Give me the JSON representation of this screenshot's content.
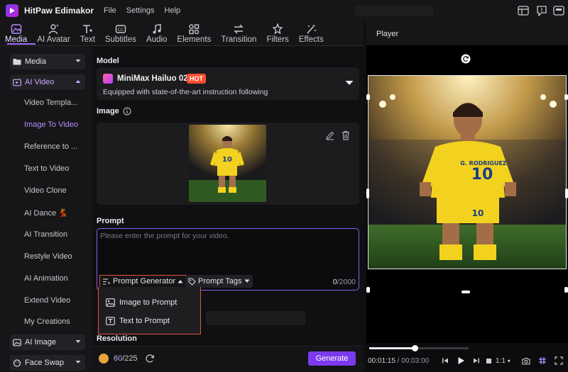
{
  "app": {
    "title": "HitPaw Edimakor",
    "menu": [
      "File",
      "Settings",
      "Help"
    ]
  },
  "toolbar": {
    "tabs": [
      {
        "label": "Media",
        "icon": "media-icon",
        "active": true
      },
      {
        "label": "AI Avatar",
        "icon": "avatar-icon"
      },
      {
        "label": "Text",
        "icon": "text-icon"
      },
      {
        "label": "Subtitles",
        "icon": "subtitles-icon"
      },
      {
        "label": "Audio",
        "icon": "audio-icon"
      },
      {
        "label": "Elements",
        "icon": "elements-icon"
      },
      {
        "label": "Transition",
        "icon": "transition-icon"
      },
      {
        "label": "Filters",
        "icon": "filters-icon"
      },
      {
        "label": "Effects",
        "icon": "effects-icon"
      }
    ]
  },
  "sidebar": {
    "media": "Media",
    "ai_video": "AI Video",
    "items": [
      "Video Templa...",
      "Image To Video",
      "Reference to ...",
      "Text to Video",
      "Video Clone",
      "AI Dance 💃",
      "AI Transition",
      "Restyle Video",
      "AI Animation",
      "Extend Video",
      "My Creations"
    ],
    "active_item": "Image To Video",
    "ai_image": "AI Image",
    "face_swap": "Face Swap"
  },
  "main": {
    "model_label": "Model",
    "model_name": "MiniMax Hailuo 02",
    "hot_badge": "HOT",
    "model_desc": "Equipped with state-of-the-art instruction following",
    "image_label": "Image",
    "prompt_label": "Prompt",
    "prompt_placeholder": "Please enter the prompt for your video.",
    "prompt_generator": "Prompt Generator",
    "prompt_tags": "Prompt Tags",
    "char_count": "0",
    "char_max": "/2000",
    "dropdown": {
      "image_to_prompt": "Image to Prompt",
      "text_to_prompt": "Text to Prompt"
    },
    "resolution_label": "Resolution",
    "credits_used": "60",
    "credits_total": "/225",
    "generate": "Generate"
  },
  "player": {
    "title": "Player",
    "current_time": "00:01:15",
    "total_time": "/ 00:03:00",
    "ratio": "1:1",
    "progress": 0.46
  },
  "colors": {
    "accent": "#7c3aed",
    "accent_light": "#b68cff",
    "highlight_border": "#e0533d",
    "hot": "#ff4d2e"
  }
}
